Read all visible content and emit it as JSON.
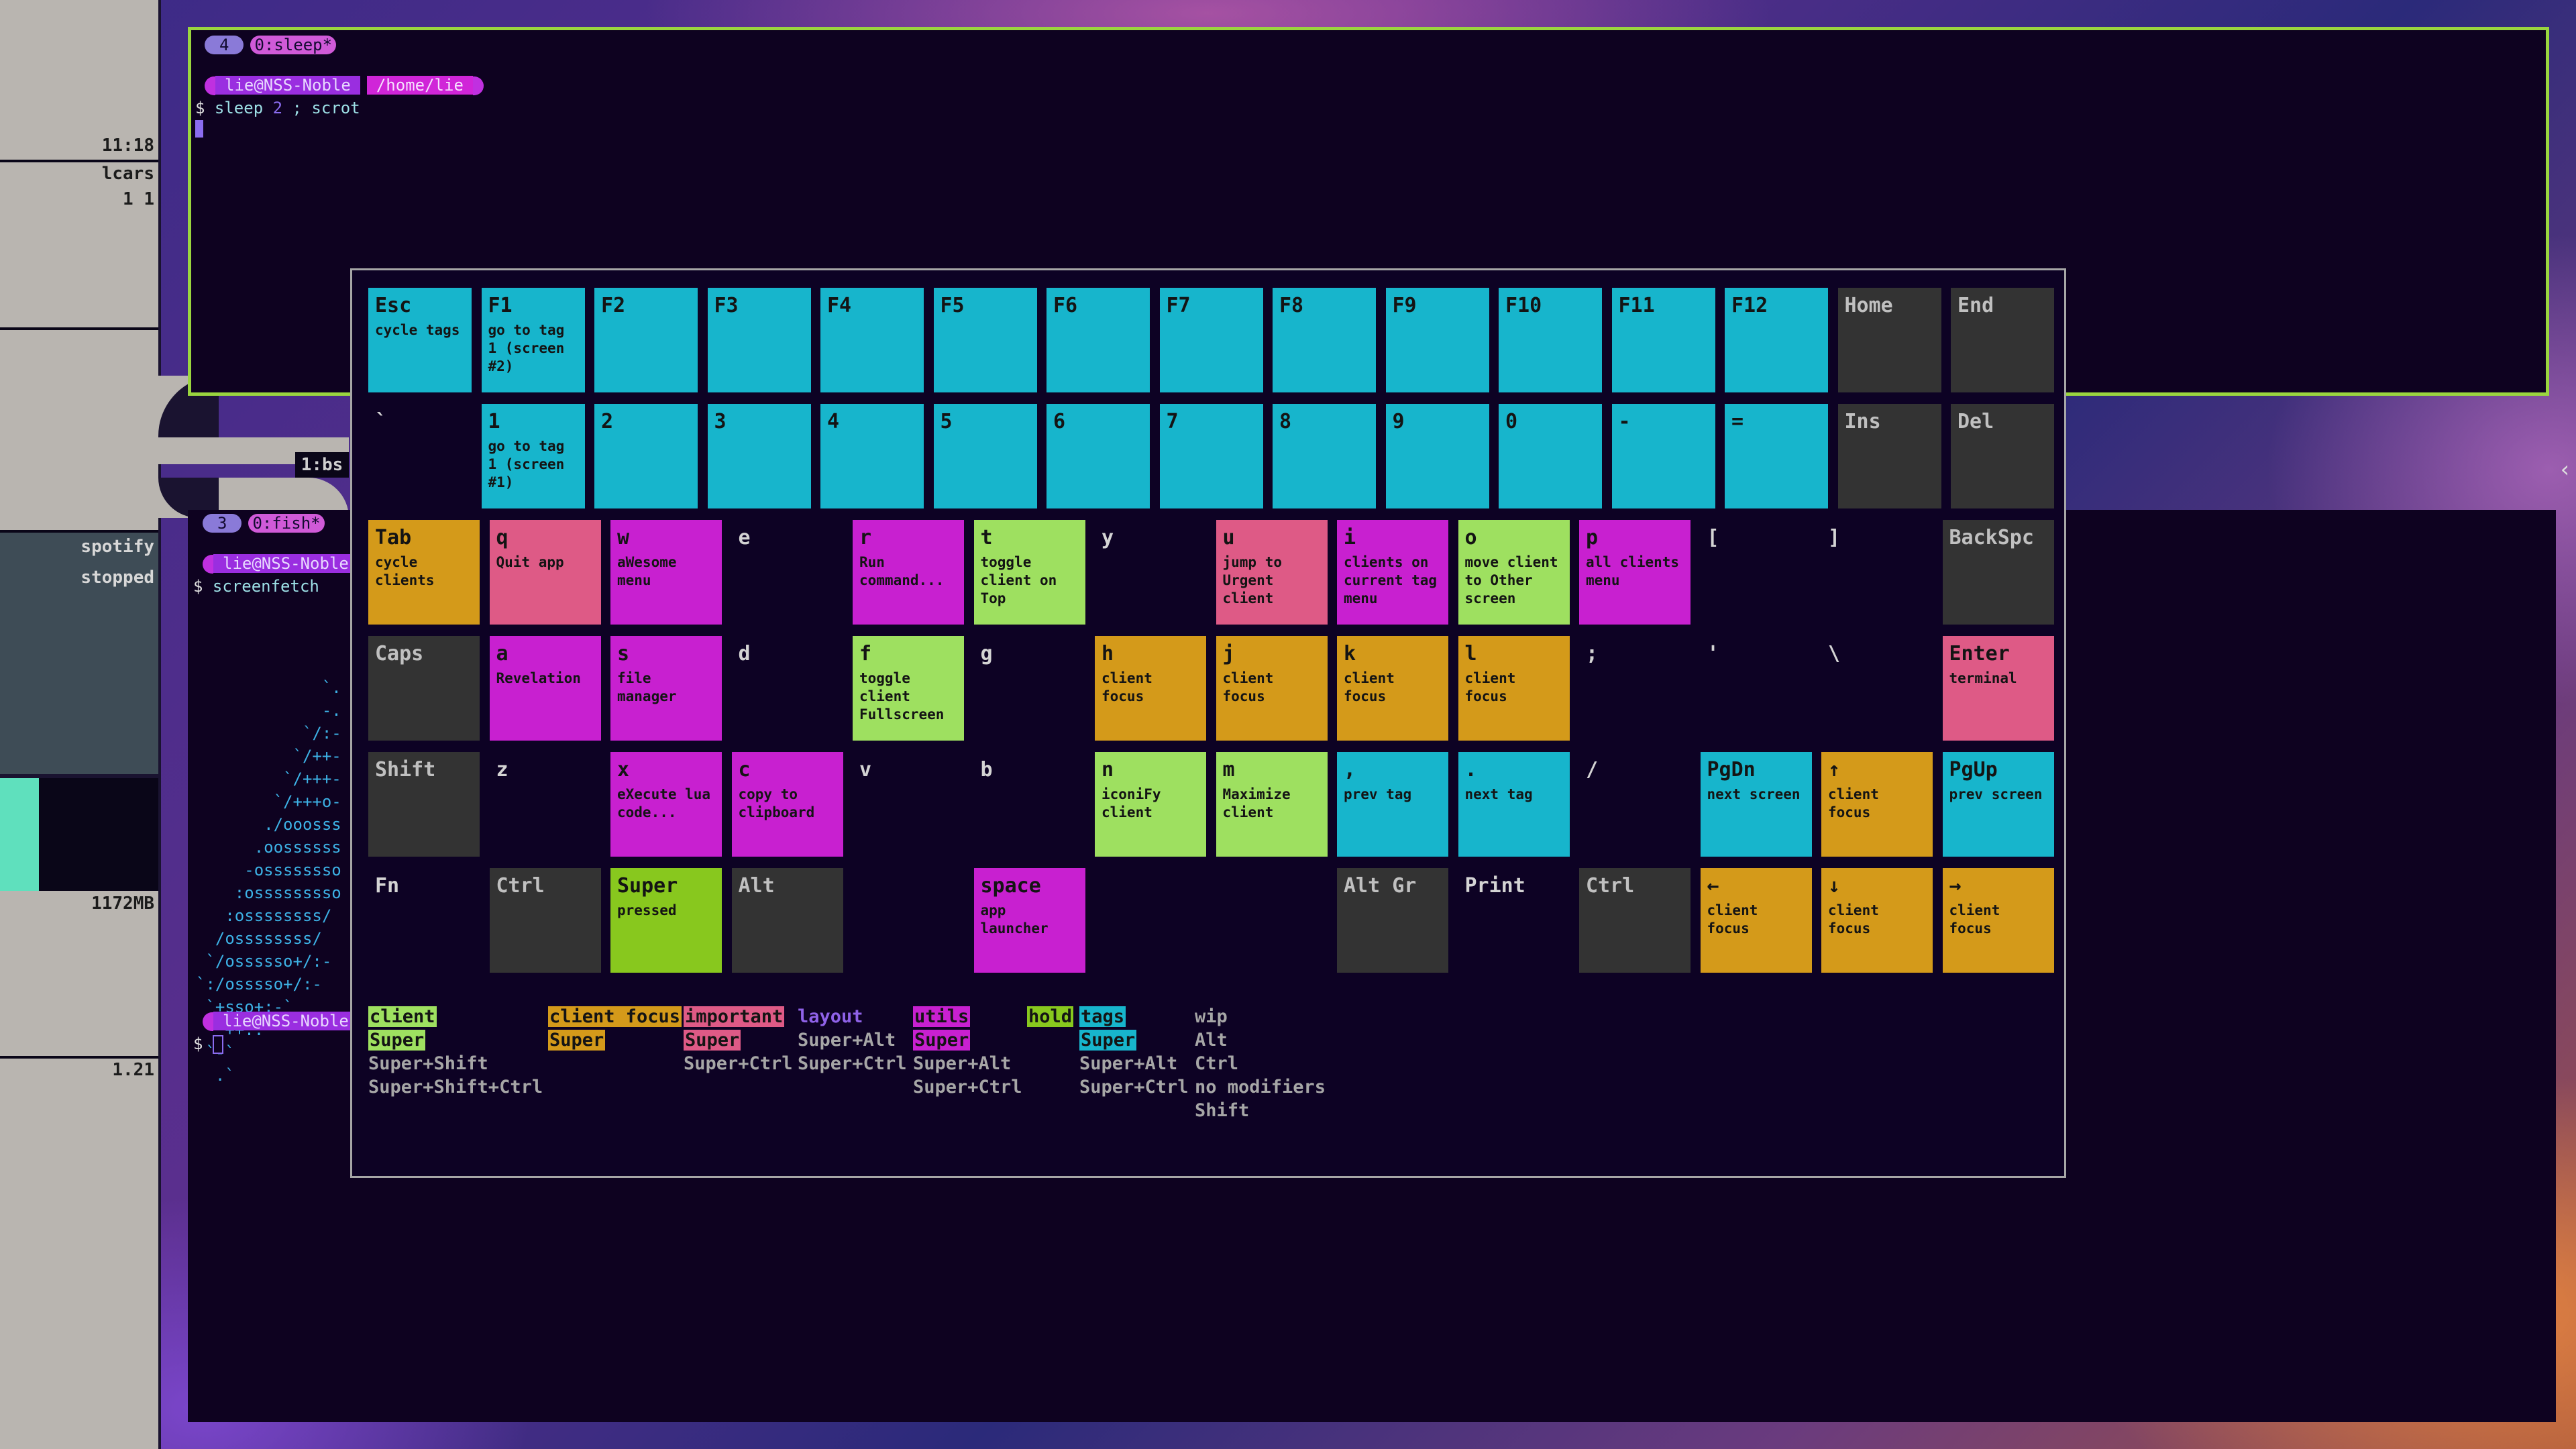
{
  "sidebar": {
    "clock": "11:18",
    "wm_name": "lcars",
    "wm_tags": "1 1",
    "tag_label": "1:bs",
    "music_title": "spotify",
    "music_state": "stopped",
    "memory": "1172MB",
    "load": "1.21"
  },
  "term_top": {
    "tab_num": "4",
    "tab_name": "0:sleep*",
    "prompt_user": "lie@NSS-Noble",
    "prompt_dir": "/home/lie",
    "dollar": "$",
    "cmd_a": "sleep",
    "cmd_num": "2",
    "cmd_b": "; scrot"
  },
  "term_bot": {
    "tab_num": "3",
    "tab_name": "0:fish*",
    "prompt_user": "lie@NSS-Noble",
    "dollar": "$",
    "command": "screenfetch",
    "ascii": [
      "             `.",
      "             -.",
      "           `/:-",
      "          `/++-",
      "         `/+++-",
      "        `/+++o-",
      "       ./ooosss",
      "      .oossssss",
      "     -ossssssso",
      "    :osssssssso",
      "   :ossssssss/",
      "  /ossssssss/",
      " `/ossssso+/:-",
      "`:/osssso+/:-",
      " `+sso+:-`",
      "  `++:.",
      " `-`",
      "  .`"
    ]
  },
  "popup": {
    "rows": [
      [
        {
          "label": "Esc",
          "desc": "cycle tags",
          "color": "cyan"
        },
        {
          "label": "F1",
          "desc": "go to tag 1 (screen #2)",
          "color": "cyan"
        },
        {
          "label": "F2",
          "desc": "",
          "color": "cyan"
        },
        {
          "label": "F3",
          "desc": "",
          "color": "cyan"
        },
        {
          "label": "F4",
          "desc": "",
          "color": "cyan"
        },
        {
          "label": "F5",
          "desc": "",
          "color": "cyan"
        },
        {
          "label": "F6",
          "desc": "",
          "color": "cyan"
        },
        {
          "label": "F7",
          "desc": "",
          "color": "cyan"
        },
        {
          "label": "F8",
          "desc": "",
          "color": "cyan"
        },
        {
          "label": "F9",
          "desc": "",
          "color": "cyan"
        },
        {
          "label": "F10",
          "desc": "",
          "color": "cyan"
        },
        {
          "label": "F11",
          "desc": "",
          "color": "cyan"
        },
        {
          "label": "F12",
          "desc": "",
          "color": "cyan"
        },
        {
          "label": "Home",
          "desc": "",
          "color": "grey"
        },
        {
          "label": "End",
          "desc": "",
          "color": "grey"
        }
      ],
      [
        {
          "label": "`",
          "desc": "",
          "color": "none"
        },
        {
          "label": "1",
          "desc": "go to tag 1 (screen #1)",
          "color": "cyan"
        },
        {
          "label": "2",
          "desc": "",
          "color": "cyan"
        },
        {
          "label": "3",
          "desc": "",
          "color": "cyan"
        },
        {
          "label": "4",
          "desc": "",
          "color": "cyan"
        },
        {
          "label": "5",
          "desc": "",
          "color": "cyan"
        },
        {
          "label": "6",
          "desc": "",
          "color": "cyan"
        },
        {
          "label": "7",
          "desc": "",
          "color": "cyan"
        },
        {
          "label": "8",
          "desc": "",
          "color": "cyan"
        },
        {
          "label": "9",
          "desc": "",
          "color": "cyan"
        },
        {
          "label": "0",
          "desc": "",
          "color": "cyan"
        },
        {
          "label": "-",
          "desc": "",
          "color": "cyan"
        },
        {
          "label": "=",
          "desc": "",
          "color": "cyan"
        },
        {
          "label": "Ins",
          "desc": "",
          "color": "grey"
        },
        {
          "label": "Del",
          "desc": "",
          "color": "grey"
        }
      ],
      [
        {
          "label": "Tab",
          "desc": "cycle clients",
          "color": "orange"
        },
        {
          "label": "q",
          "desc": "Quit app",
          "color": "pink"
        },
        {
          "label": "w",
          "desc": "aWesome menu",
          "color": "magenta"
        },
        {
          "label": "e",
          "desc": "",
          "color": "none"
        },
        {
          "label": "r",
          "desc": "Run command...",
          "color": "magenta"
        },
        {
          "label": "t",
          "desc": "toggle client on Top",
          "color": "lime"
        },
        {
          "label": "y",
          "desc": "",
          "color": "none"
        },
        {
          "label": "u",
          "desc": "jump to Urgent client",
          "color": "pink"
        },
        {
          "label": "i",
          "desc": "clients on current tag menu",
          "color": "magenta"
        },
        {
          "label": "o",
          "desc": "move client to Other screen",
          "color": "lime"
        },
        {
          "label": "p",
          "desc": "all clients menu",
          "color": "magenta"
        },
        {
          "label": "[",
          "desc": "",
          "color": "none"
        },
        {
          "label": "]",
          "desc": "",
          "color": "none"
        },
        {
          "label": "BackSpc",
          "desc": "",
          "color": "grey"
        }
      ],
      [
        {
          "label": "Caps",
          "desc": "",
          "color": "grey"
        },
        {
          "label": "a",
          "desc": "Revelation",
          "color": "magenta"
        },
        {
          "label": "s",
          "desc": "file manager",
          "color": "magenta"
        },
        {
          "label": "d",
          "desc": "",
          "color": "none"
        },
        {
          "label": "f",
          "desc": "toggle client Fullscreen",
          "color": "lime"
        },
        {
          "label": "g",
          "desc": "",
          "color": "none"
        },
        {
          "label": "h",
          "desc": "client focus",
          "color": "orange"
        },
        {
          "label": "j",
          "desc": "client focus",
          "color": "orange"
        },
        {
          "label": "k",
          "desc": "client focus",
          "color": "orange"
        },
        {
          "label": "l",
          "desc": "client focus",
          "color": "orange"
        },
        {
          "label": ";",
          "desc": "",
          "color": "none"
        },
        {
          "label": "'",
          "desc": "",
          "color": "none"
        },
        {
          "label": "\\",
          "desc": "",
          "color": "none"
        },
        {
          "label": "Enter",
          "desc": "terminal",
          "color": "pink"
        }
      ],
      [
        {
          "label": "Shift",
          "desc": "",
          "color": "grey"
        },
        {
          "label": "z",
          "desc": "",
          "color": "none"
        },
        {
          "label": "x",
          "desc": "eXecute lua code...",
          "color": "magenta"
        },
        {
          "label": "c",
          "desc": "copy to clipboard",
          "color": "magenta"
        },
        {
          "label": "v",
          "desc": "",
          "color": "none"
        },
        {
          "label": "b",
          "desc": "",
          "color": "none"
        },
        {
          "label": "n",
          "desc": "iconiFy client",
          "color": "lime"
        },
        {
          "label": "m",
          "desc": "Maximize client",
          "color": "lime"
        },
        {
          "label": ",",
          "desc": "prev tag",
          "color": "cyan"
        },
        {
          "label": ".",
          "desc": "next tag",
          "color": "cyan"
        },
        {
          "label": "/",
          "desc": "",
          "color": "none"
        },
        {
          "label": "PgDn",
          "desc": "next screen",
          "color": "cyan"
        },
        {
          "label": "↑",
          "desc": "client focus",
          "color": "orange"
        },
        {
          "label": "PgUp",
          "desc": "prev screen",
          "color": "cyan"
        }
      ],
      [
        {
          "label": "Fn",
          "desc": "",
          "color": "none"
        },
        {
          "label": "Ctrl",
          "desc": "",
          "color": "grey"
        },
        {
          "label": "Super",
          "desc": "pressed",
          "color": "green"
        },
        {
          "label": "Alt",
          "desc": "",
          "color": "grey"
        },
        {
          "label": "space",
          "desc": "app launcher",
          "color": "magenta"
        },
        {
          "label": "Alt Gr",
          "desc": "",
          "color": "grey"
        },
        {
          "label": "Print",
          "desc": "",
          "color": "none"
        },
        {
          "label": "Ctrl",
          "desc": "",
          "color": "grey"
        },
        {
          "label": "←",
          "desc": "client focus",
          "color": "orange"
        },
        {
          "label": "↓",
          "desc": "client focus",
          "color": "orange"
        },
        {
          "label": "→",
          "desc": "client focus",
          "color": "orange"
        }
      ]
    ],
    "legend": [
      {
        "title": "client",
        "title_color": "lime",
        "lines": [
          {
            "text": "Super",
            "color": "lime"
          },
          {
            "text": "Super+Shift",
            "color": "plain"
          },
          {
            "text": "Super+Shift+Ctrl",
            "color": "plain"
          }
        ]
      },
      {
        "title": "client focus",
        "title_color": "orange",
        "lines": [
          {
            "text": "Super",
            "color": "orange"
          }
        ]
      },
      {
        "title": "important",
        "title_color": "pink",
        "lines": [
          {
            "text": "Super",
            "color": "pink"
          },
          {
            "text": "Super+Ctrl",
            "color": "plain"
          }
        ]
      },
      {
        "title": "layout",
        "title_color": "purple",
        "lines": [
          {
            "text": "Super+Alt",
            "color": "plain"
          },
          {
            "text": "Super+Ctrl",
            "color": "plain"
          }
        ]
      },
      {
        "title": "utils",
        "title_color": "magenta",
        "lines": [
          {
            "text": "Super",
            "color": "magenta"
          },
          {
            "text": "Super+Alt",
            "color": "plain"
          },
          {
            "text": "Super+Ctrl",
            "color": "plain"
          }
        ]
      },
      {
        "title": "hold",
        "title_color": "green",
        "lines": []
      },
      {
        "title": "tags",
        "title_color": "cyan",
        "lines": [
          {
            "text": "Super",
            "color": "cyan"
          },
          {
            "text": "Super+Alt",
            "color": "plain"
          },
          {
            "text": "Super+Ctrl",
            "color": "plain"
          }
        ]
      },
      {
        "title": "wip",
        "title_color": "plain",
        "lines": [
          {
            "text": "Alt",
            "color": "plain"
          },
          {
            "text": "Ctrl",
            "color": "plain"
          },
          {
            "text": "no modifiers",
            "color": "plain"
          },
          {
            "text": "Shift",
            "color": "plain"
          }
        ]
      }
    ]
  },
  "colors": {
    "cyan": "#17b5cc",
    "orange": "#d49a1a",
    "pink": "#de5a86",
    "magenta": "#c820d0",
    "lime": "#9ee060",
    "green": "#88c81e",
    "grey": "#333333",
    "border_active": "#9ad53f"
  },
  "edge_arrow": "‹"
}
